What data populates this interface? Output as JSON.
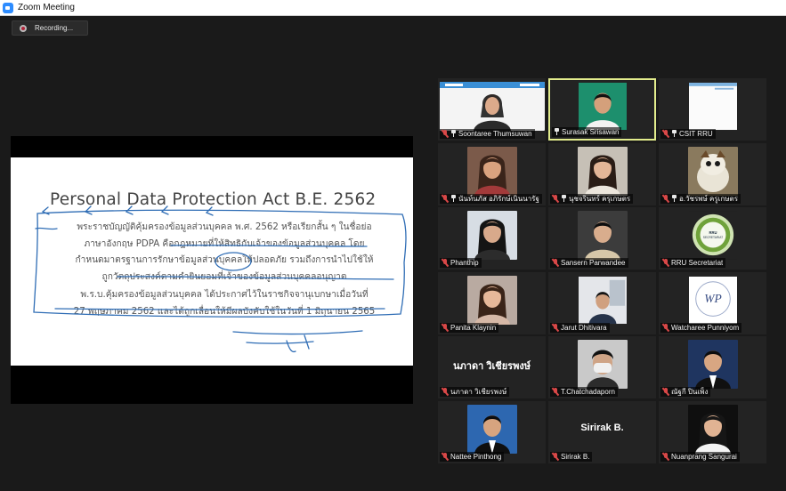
{
  "window": {
    "title": "Zoom Meeting"
  },
  "recording": {
    "label": "Recording..."
  },
  "shared_slide": {
    "title": "Personal Data Protection Act B.E. 2562",
    "paragraph1": [
      "พระราชบัญญัติคุ้มครองข้อมูลส่วนบุคคล พ.ศ. 2562 หรือเรียกสั้น ๆ ในชื่อย่อ",
      "ภาษาอังกฤษ PDPA คือกฎหมายที่ให้สิทธิกับเจ้าของข้อมูลส่วนบุคคล โดย",
      "กำหนดมาตรฐานการรักษาข้อมูลส่วนบุคคลให้ปลอดภัย รวมถึงการนำไปใช้ให้",
      "ถูกวัตถุประสงค์ตามคำยินยอมที่เจ้าของข้อมูลส่วนบุคคลอนุญาต"
    ],
    "paragraph2": [
      "พ.ร.บ.คุ้มครองข้อมูลส่วนบุคคล ได้ประกาศไว้ในราชกิจจานุเบกษาเมื่อวันที่",
      "27 พฤษภาคม 2562 และได้ถูกเลื่อนให้มีผลบังคับใช้ในวันที่ 1 มิถุนายน 2565"
    ],
    "accent_color": "#a8321e",
    "ink_color": "#2f6db5"
  },
  "participants": [
    {
      "name": "Soontaree Thumsuwan",
      "muted": true,
      "pinned": true,
      "video": "woman-banner"
    },
    {
      "name": "Surasak Srisawan",
      "muted": false,
      "pinned": true,
      "video": "man-green",
      "active_speaker": true
    },
    {
      "name": "CSIT RRU",
      "muted": true,
      "pinned": true,
      "video": "whiteboard"
    },
    {
      "name": "นันท์นภัส อภิรักษ์เนินนารัฐ",
      "muted": true,
      "pinned": true,
      "video": "woman-outdoor"
    },
    {
      "name": "นุชจรินทร์ ครุเกษตร",
      "muted": true,
      "pinned": true,
      "video": "woman-indoor"
    },
    {
      "name": "อ.วัชรพษ์ ครูเกษตร",
      "muted": true,
      "pinned": true,
      "video": "cartoon"
    },
    {
      "name": "Phanthip",
      "muted": true,
      "pinned": false,
      "video": "woman-dark-hair"
    },
    {
      "name": "Sansern Parwandee",
      "muted": true,
      "pinned": false,
      "video": "child"
    },
    {
      "name": "RRU Secretariat",
      "muted": true,
      "pinned": false,
      "video": "logo-secretariat",
      "logo_text": "RRU SECRETARIAT"
    },
    {
      "name": "Panita Klaynin",
      "muted": true,
      "pinned": false,
      "video": "woman-long-hair"
    },
    {
      "name": "Jarut Dhitivara",
      "muted": true,
      "pinned": false,
      "video": "man-desk"
    },
    {
      "name": "Watcharee Punniyom",
      "muted": true,
      "pinned": false,
      "video": "logo-wp",
      "logo_text": "WP"
    },
    {
      "name": "นภาดา วิเชียรพงษ์",
      "muted": true,
      "pinned": false,
      "video": "none",
      "display_name": "นภาดา วิเชียรพงษ์"
    },
    {
      "name": "T.Chatchadaporn",
      "muted": true,
      "pinned": false,
      "video": "mask"
    },
    {
      "name": "ณัฐกี ปินเพ็ง",
      "muted": true,
      "pinned": false,
      "video": "man-suit"
    },
    {
      "name": "Nattee Pinthong",
      "muted": true,
      "pinned": false,
      "video": "man-suit-blue"
    },
    {
      "name": "Sirirak B.",
      "muted": true,
      "pinned": false,
      "video": "none",
      "display_name": "Sirirak B."
    },
    {
      "name": "Nuanprang Sangurai",
      "muted": true,
      "pinned": false,
      "video": "woman-smile"
    }
  ]
}
